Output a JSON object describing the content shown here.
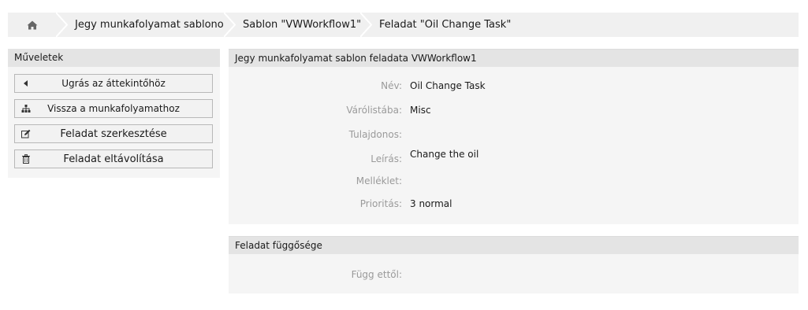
{
  "breadcrumb": {
    "home_icon": "home-icon",
    "items": [
      "Jegy munkafolyamat sablonok",
      "Sablon \"VWWorkflow1\"",
      "Feladat \"Oil Change Task\""
    ]
  },
  "sidebar": {
    "title": "Műveletek",
    "actions": [
      {
        "label": "Ugrás az áttekintőhöz",
        "icon": "caret-left-icon"
      },
      {
        "label": "Vissza a munkafolyamathoz",
        "icon": "sitemap-icon"
      },
      {
        "label": "Feladat szerkesztése",
        "icon": "edit-icon"
      },
      {
        "label": "Feladat eltávolítása",
        "icon": "trash-icon"
      }
    ]
  },
  "details": {
    "title": "Jegy munkafolyamat sablon feladata VWWorkflow1",
    "fields": [
      {
        "label": "Név:",
        "value": "Oil Change Task"
      },
      {
        "label": "Várólistába:",
        "value": "Misc"
      },
      {
        "label": "Tulajdonos:",
        "value": ""
      },
      {
        "label": "Leírás:",
        "value": "Change the oil"
      },
      {
        "label": "Melléklet:",
        "value": ""
      },
      {
        "label": "Prioritás:",
        "value": "3 normal"
      }
    ]
  },
  "dependency": {
    "title": "Feladat függősége",
    "fields": [
      {
        "label": "Függ ettől:",
        "value": ""
      }
    ]
  }
}
